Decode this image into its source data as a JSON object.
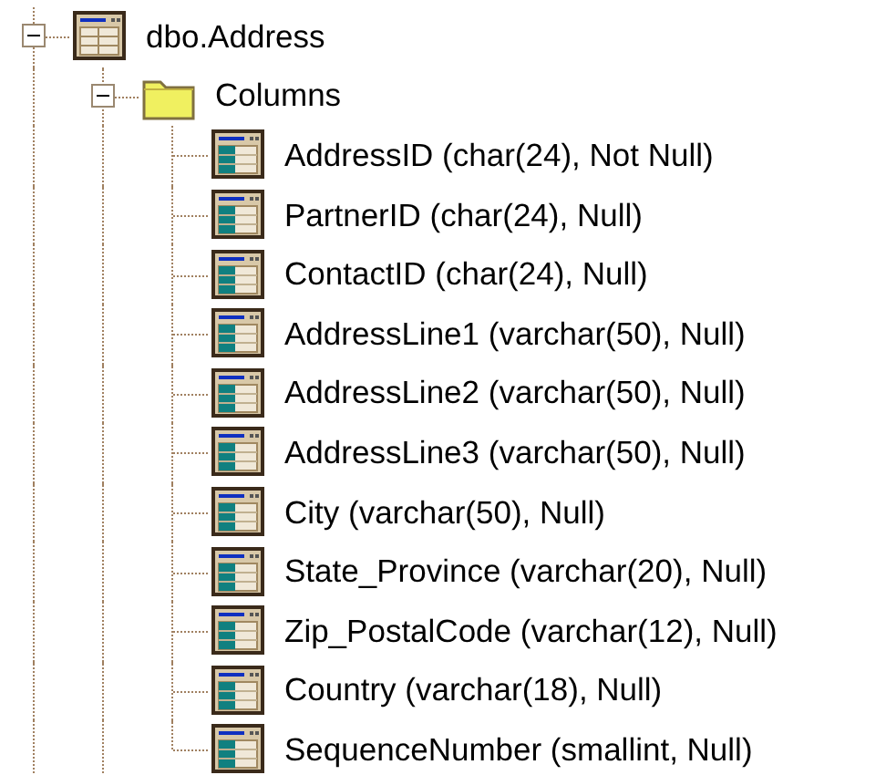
{
  "tree": [
    {
      "label": "dbo.Address",
      "kind": "table",
      "expanded": true,
      "children": [
        {
          "label": "Columns",
          "kind": "folder",
          "expanded": true,
          "children": [
            {
              "label": "AddressID (char(24), Not Null)",
              "kind": "column"
            },
            {
              "label": "PartnerID (char(24), Null)",
              "kind": "column"
            },
            {
              "label": "ContactID (char(24), Null)",
              "kind": "column"
            },
            {
              "label": "AddressLine1 (varchar(50), Null)",
              "kind": "column"
            },
            {
              "label": "AddressLine2 (varchar(50), Null)",
              "kind": "column"
            },
            {
              "label": "AddressLine3 (varchar(50), Null)",
              "kind": "column"
            },
            {
              "label": "City (varchar(50), Null)",
              "kind": "column"
            },
            {
              "label": "State_Province (varchar(20), Null)",
              "kind": "column"
            },
            {
              "label": "Zip_PostalCode (varchar(12), Null)",
              "kind": "column"
            },
            {
              "label": "Country (varchar(18), Null)",
              "kind": "column"
            },
            {
              "label": "SequenceNumber (smallint, Null)",
              "kind": "column"
            }
          ]
        }
      ]
    }
  ]
}
